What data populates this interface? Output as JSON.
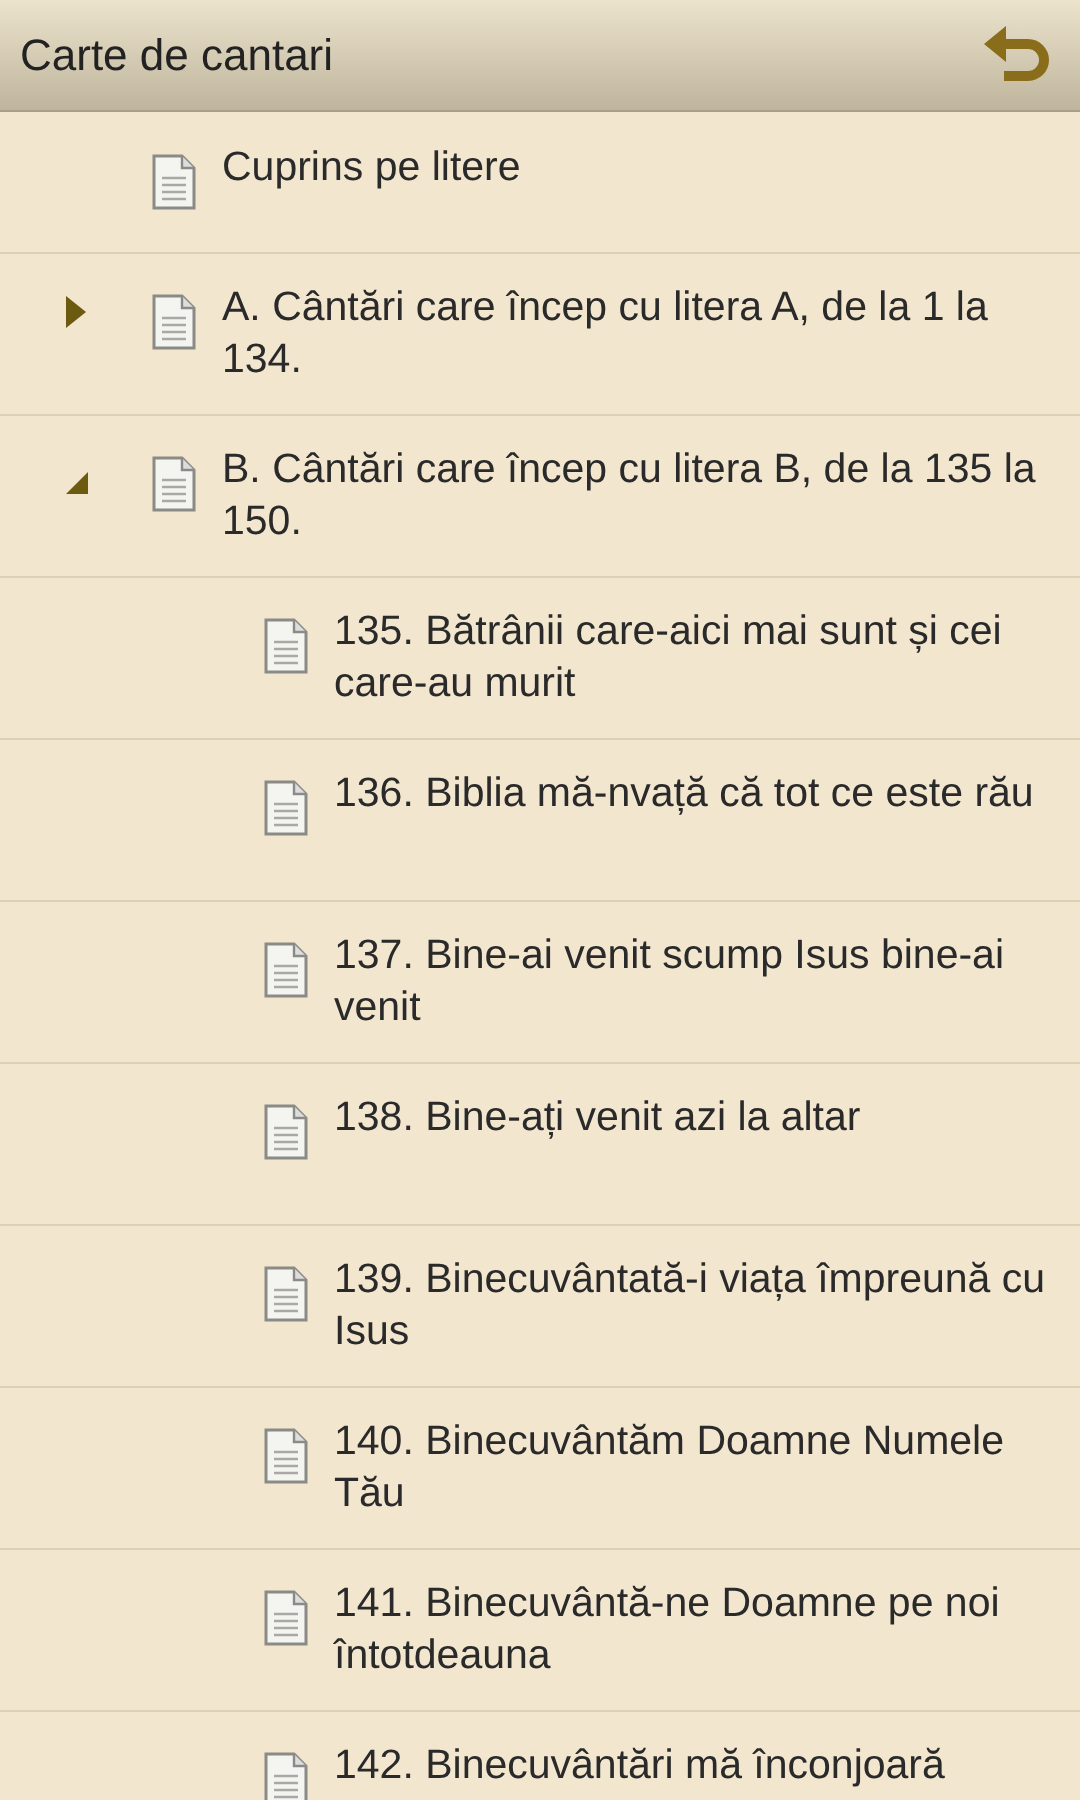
{
  "title_bar": {
    "title": "Carte de cantari"
  },
  "items": [
    {
      "label": "Cuprins pe litere"
    },
    {
      "label": "A. Cântări care încep cu litera A, de la 1 la 134.",
      "expanded": false
    },
    {
      "label": "B. Cântări care încep cu litera B, de la 135 la 150.",
      "expanded": true,
      "children": [
        {
          "label": "135. Bătrânii care-aici mai sunt și cei care-au murit"
        },
        {
          "label": "136. Biblia mă-nvață că tot ce este rău"
        },
        {
          "label": "137. Bine-ai venit scump Isus bine-ai venit"
        },
        {
          "label": "138. Bine-ați venit azi la altar"
        },
        {
          "label": "139. Binecuvântată-i viața împreună cu Isus"
        },
        {
          "label": "140. Binecuvântăm Doamne Numele Tău"
        },
        {
          "label": "141. Binecuvântă-ne Doamne pe noi întotdeauna"
        },
        {
          "label": "142. Binecuvântări mă înconjoară"
        }
      ]
    }
  ]
}
